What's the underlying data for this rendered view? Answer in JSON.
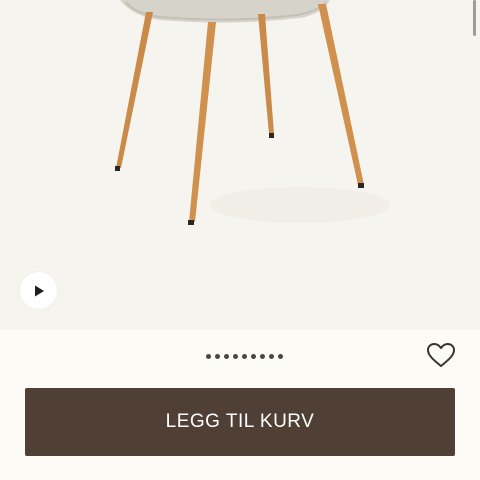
{
  "product_gallery": {
    "image_subject": "chair-icon",
    "play_icon": "play-icon",
    "pager": {
      "count": 9,
      "active_index": 0
    }
  },
  "favorite": {
    "icon": "heart-outline-icon"
  },
  "cart_button": {
    "label": "LEGG TIL KURV"
  },
  "colors": {
    "button_bg": "#4f3f35",
    "dot_color": "#4f4540",
    "page_bg": "#fdfbf6",
    "image_bg": "#f6f4ef",
    "leg_color": "#c98a4a",
    "seat_color": "#d6d3ca"
  }
}
